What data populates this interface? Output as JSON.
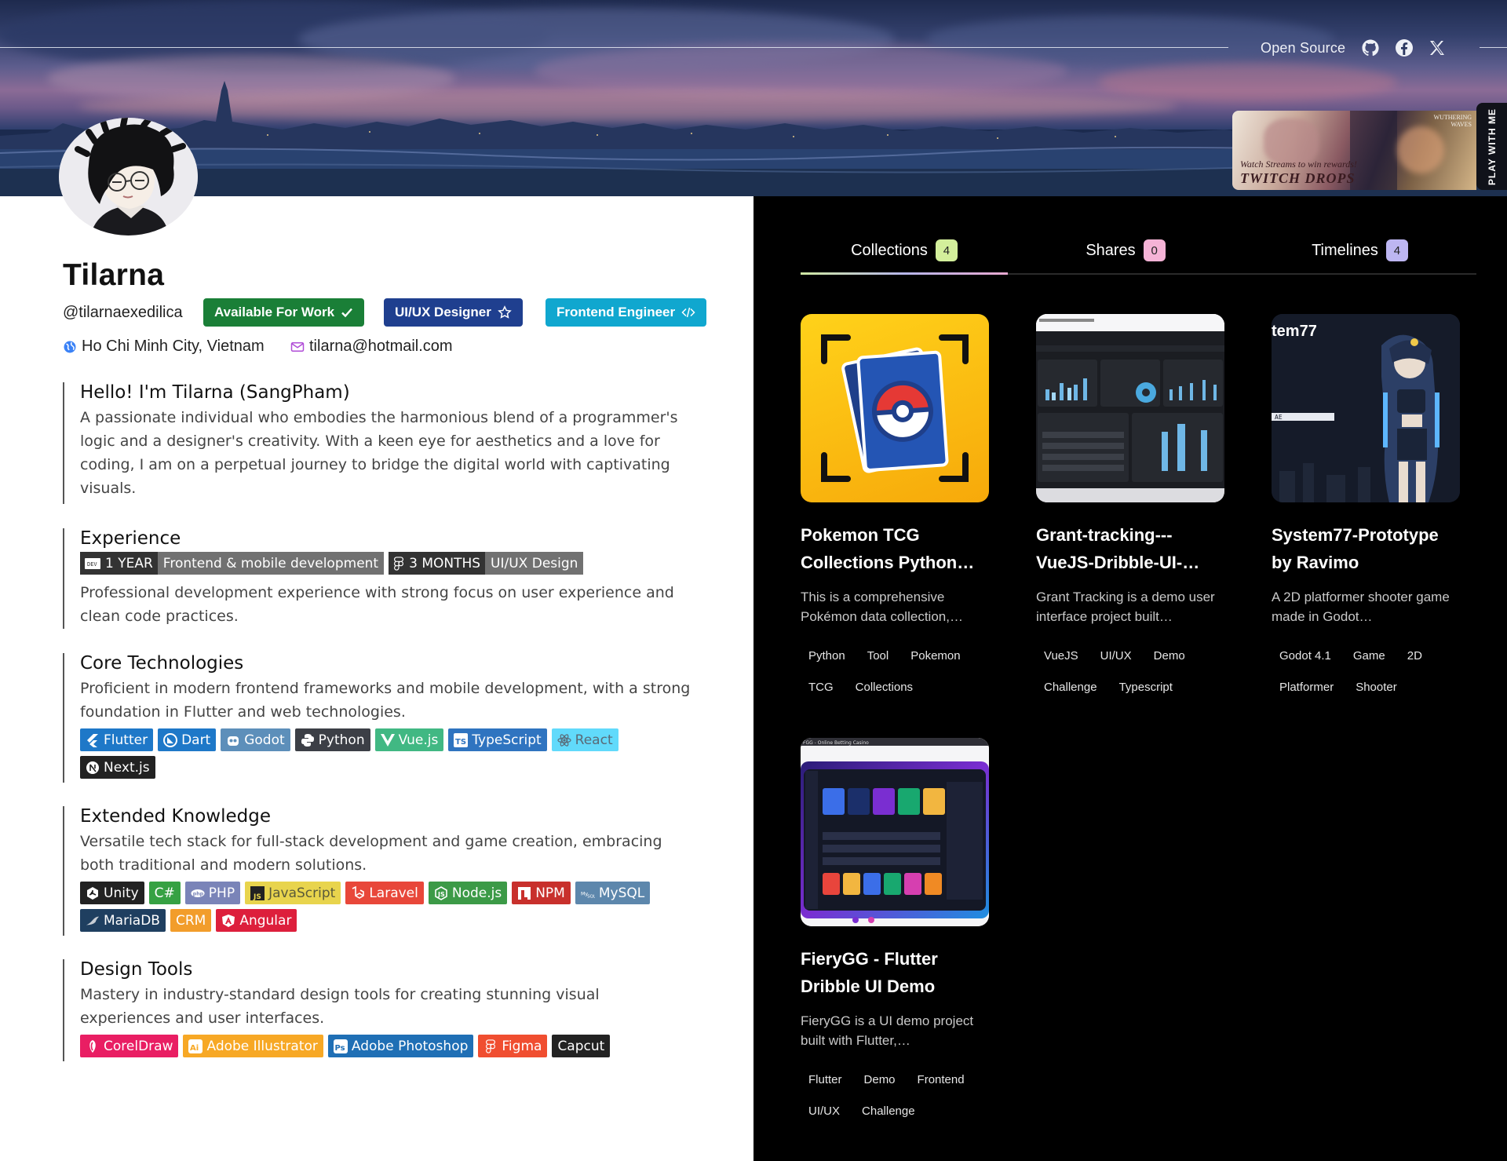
{
  "nav": {
    "open_source_label": "Open Source",
    "icons": [
      "github-icon",
      "facebook-icon",
      "x-icon"
    ]
  },
  "twitch": {
    "side_label": "PLAY WITH ME",
    "caption_small": "Watch Streams to win rewards!",
    "caption_big": "TWITCH DROPS",
    "corner_text_1": "WUTHERING",
    "corner_text_2": "WAVES"
  },
  "profile": {
    "name": "Tilarna",
    "handle": "@tilarnaexedilica",
    "badges": [
      {
        "label": "Available For Work",
        "color": "#1a7f37",
        "icon": "check-icon"
      },
      {
        "label": "UI/UX Designer",
        "color": "#1f3f8f",
        "icon": "star-icon"
      },
      {
        "label": "Frontend Engineer",
        "color": "#10a7cf",
        "icon": "code-icon"
      }
    ],
    "location": "Ho Chi Minh City, Vietnam",
    "email": "tilarna@hotmail.com"
  },
  "sections": {
    "intro": {
      "title": "Hello! I'm Tilarna (SangPham)",
      "text": "A passionate individual who embodies the harmonious blend of a programmer's logic and a designer's creativity. With a keen eye for aesthetics and a love for coding, I am on a perpetual journey to bridge the digital world with captivating visuals."
    },
    "experience": {
      "title": "Experience",
      "chips": [
        {
          "duration": "1 YEAR",
          "field": "Frontend & mobile development",
          "icon": "dev-icon"
        },
        {
          "duration": "3 MONTHS",
          "field": "UI/UX Design",
          "icon": "figma-icon"
        }
      ],
      "text": "Professional development experience with strong focus on user experience and clean code practices."
    },
    "core": {
      "title": "Core Technologies",
      "text": "Proficient in modern frontend frameworks and mobile development, with a strong foundation in Flutter and web technologies.",
      "chips": [
        {
          "label": "Flutter",
          "color": "#1e78c8",
          "icon": "flutter-icon"
        },
        {
          "label": "Dart",
          "color": "#1e78c8",
          "icon": "dart-icon"
        },
        {
          "label": "Godot",
          "color": "#5d8fba",
          "icon": "godot-icon"
        },
        {
          "label": "Python",
          "color": "#3c3f46",
          "icon": "python-icon"
        },
        {
          "label": "Vue.js",
          "color": "#41b883",
          "icon": "vue-icon"
        },
        {
          "label": "TypeScript",
          "color": "#2f74c0",
          "icon": "typescript-icon"
        },
        {
          "label": "React",
          "color": "#61dafb",
          "icon": "react-icon",
          "text_color": "#5a6a77"
        },
        {
          "label": "Next.js",
          "color": "#222222",
          "icon": "nextjs-icon"
        }
      ]
    },
    "extended": {
      "title": "Extended Knowledge",
      "text": "Versatile tech stack for full-stack development and game creation, embracing both traditional and modern solutions.",
      "chips": [
        {
          "label": "Unity",
          "color": "#222222",
          "icon": "unity-icon"
        },
        {
          "label": "C#",
          "color": "#36a143",
          "icon": "csharp-icon"
        },
        {
          "label": "PHP",
          "color": "#7a84b8",
          "icon": "php-icon"
        },
        {
          "label": "JavaScript",
          "color": "#e8d44d",
          "icon": "javascript-icon",
          "text_color": "#5a5a3a"
        },
        {
          "label": "Laravel",
          "color": "#e8473a",
          "icon": "laravel-icon"
        },
        {
          "label": "Node.js",
          "color": "#3c9a47",
          "icon": "nodejs-icon"
        },
        {
          "label": "NPM",
          "color": "#c8302c",
          "icon": "npm-icon"
        },
        {
          "label": "MySQL",
          "color": "#5d87ac",
          "icon": "mysql-icon"
        },
        {
          "label": "MariaDB",
          "color": "#1f3f60",
          "icon": "mariadb-icon"
        },
        {
          "label": "CRM",
          "color": "#f29d2b",
          "icon": ""
        },
        {
          "label": "Angular",
          "color": "#dd1f3c",
          "icon": "angular-icon"
        }
      ]
    },
    "design": {
      "title": "Design Tools",
      "text": "Mastery in industry-standard design tools for creating stunning visual experiences and user interfaces.",
      "chips": [
        {
          "label": "CorelDraw",
          "color": "#e91e63",
          "icon": "coreldraw-icon"
        },
        {
          "label": "Adobe Illustrator",
          "color": "#f7a825",
          "icon": "illustrator-icon"
        },
        {
          "label": "Adobe Photoshop",
          "color": "#1f6fb5",
          "icon": "photoshop-icon"
        },
        {
          "label": "Figma",
          "color": "#f04e30",
          "icon": "figma-icon"
        },
        {
          "label": "Capcut",
          "color": "#222222",
          "icon": ""
        }
      ]
    }
  },
  "tabs": [
    {
      "label": "Collections",
      "count": "4",
      "color": "#d3ef9b"
    },
    {
      "label": "Shares",
      "count": "0",
      "color": "#f5b3d6"
    },
    {
      "label": "Timelines",
      "count": "4",
      "color": "#bdb6f2"
    }
  ],
  "cards": [
    {
      "title": "Pokemon TCG Collections Python…",
      "desc": "This is a comprehensive Pokémon data collection,…",
      "tags": [
        "Python",
        "Tool",
        "Pokemon",
        "TCG",
        "Collections"
      ],
      "thumb": "pokemon-tcg-app-icon"
    },
    {
      "title": "Grant-tracking---VueJS-Dribble-UI-…",
      "desc": "Grant Tracking is a demo user interface project built…",
      "tags": [
        "VueJS",
        "UI/UX",
        "Demo",
        "Challenge",
        "Typescript"
      ],
      "thumb": "dashboard-screenshot"
    },
    {
      "title": "System77-Prototype by Ravimo",
      "desc": "A 2D platformer shooter game made in Godot…",
      "tags": [
        "Godot 4.1",
        "Game",
        "2D",
        "Platformer",
        "Shooter"
      ],
      "thumb": "game-character-art",
      "thumb_text": "tem77",
      "thumb_label": "AE"
    },
    {
      "title": "FieryGG - Flutter Dribble UI Demo",
      "desc": "FieryGG is a UI demo project built with Flutter,…",
      "tags": [
        "Flutter",
        "Demo",
        "Frontend",
        "UI/UX",
        "Challenge"
      ],
      "thumb": "casino-app-screenshot",
      "thumb_text": "FGG - Online Betting Casino"
    }
  ]
}
